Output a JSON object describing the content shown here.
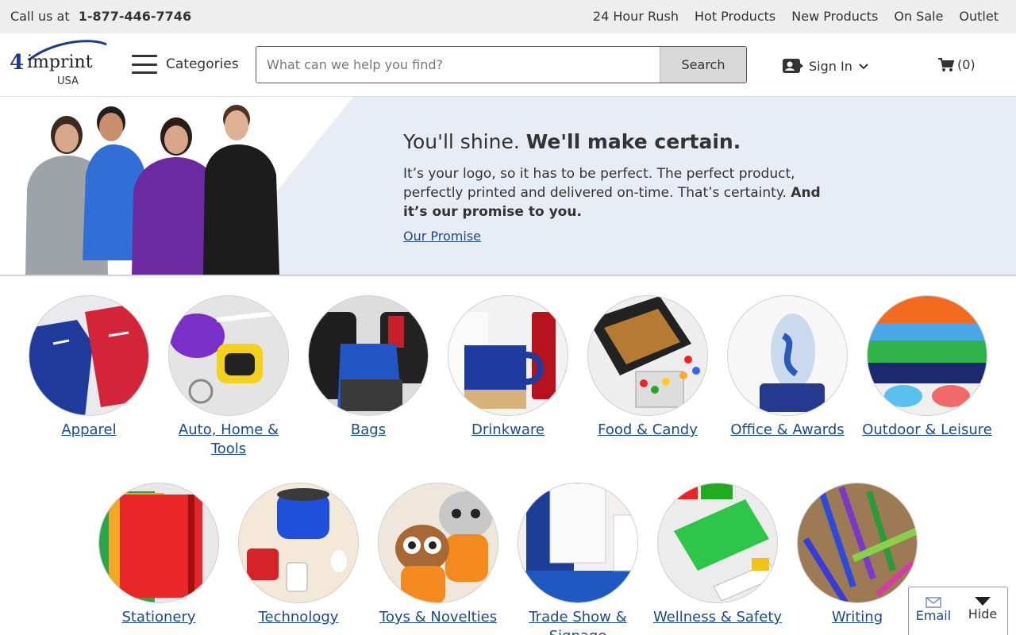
{
  "topbar": {
    "call_prefix": "Call us at",
    "phone": "1-877-446-7746",
    "links": [
      "24 Hour Rush",
      "Hot Products",
      "New Products",
      "On Sale",
      "Outlet"
    ]
  },
  "header": {
    "logo_number": "4",
    "logo_word": "imprint",
    "logo_country": "USA",
    "categories_label": "Categories",
    "search_placeholder": "What can we help you find?",
    "search_value": "",
    "search_button": "Search",
    "signin_label": "Sign In",
    "cart_count": "(0)"
  },
  "hero": {
    "title_light": "You'll shine.",
    "title_bold": "We'll make certain.",
    "body_regular": "It’s your logo, so it has to be perfect. The perfect product, perfectly printed and delivered on-time. That’s certainty.",
    "body_bold": "And it’s our promise to you.",
    "link": "Our Promise"
  },
  "categories": {
    "row1": [
      {
        "label": "Apparel"
      },
      {
        "label": "Auto, Home & Tools"
      },
      {
        "label": "Bags"
      },
      {
        "label": "Drinkware"
      },
      {
        "label": "Food & Candy"
      },
      {
        "label": "Office & Awards"
      },
      {
        "label": "Outdoor & Leisure"
      }
    ],
    "row2": [
      {
        "label": "Stationery"
      },
      {
        "label": "Technology"
      },
      {
        "label": "Toys & Novelties"
      },
      {
        "label": "Trade Show & Signage"
      },
      {
        "label": "Wellness & Safety"
      },
      {
        "label": "Writing"
      }
    ]
  },
  "feedback": {
    "email_label": "Email",
    "hide_label": "Hide"
  },
  "colors": {
    "link_blue": "#1a4b8c",
    "topbar_bg": "#eeeeee",
    "hero_bg": "#e8ecf4"
  }
}
